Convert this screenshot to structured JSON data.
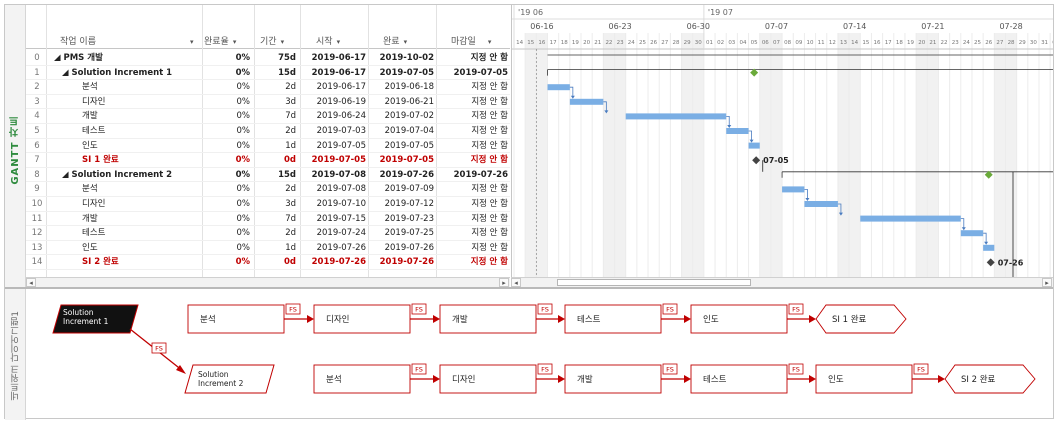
{
  "side_labels": {
    "gantt": "GANTT 차트",
    "network": "네트워크 다이어그램1"
  },
  "columns": {
    "name": "작업 이름",
    "pct": "완료율",
    "dur": "기간",
    "start": "시작",
    "end": "완료",
    "deadline": "마감일"
  },
  "rows": [
    {
      "id": "0",
      "name": "◢ PMS 개발",
      "pct": "0%",
      "dur": "75d",
      "start": "2019-06-17",
      "end": "2019-10-02",
      "deadline": "지정 안 함"
    },
    {
      "id": "1",
      "name": "◢ Solution Increment 1",
      "pct": "0%",
      "dur": "15d",
      "start": "2019-06-17",
      "end": "2019-07-05",
      "deadline": "2019-07-05"
    },
    {
      "id": "2",
      "name": "분석",
      "pct": "0%",
      "dur": "2d",
      "start": "2019-06-17",
      "end": "2019-06-18",
      "deadline": "지정 안 함"
    },
    {
      "id": "3",
      "name": "디자인",
      "pct": "0%",
      "dur": "3d",
      "start": "2019-06-19",
      "end": "2019-06-21",
      "deadline": "지정 안 함"
    },
    {
      "id": "4",
      "name": "개발",
      "pct": "0%",
      "dur": "7d",
      "start": "2019-06-24",
      "end": "2019-07-02",
      "deadline": "지정 안 함"
    },
    {
      "id": "5",
      "name": "테스트",
      "pct": "0%",
      "dur": "2d",
      "start": "2019-07-03",
      "end": "2019-07-04",
      "deadline": "지정 안 함"
    },
    {
      "id": "6",
      "name": "인도",
      "pct": "0%",
      "dur": "1d",
      "start": "2019-07-05",
      "end": "2019-07-05",
      "deadline": "지정 안 함"
    },
    {
      "id": "7",
      "name": "SI 1 완료",
      "pct": "0%",
      "dur": "0d",
      "start": "2019-07-05",
      "end": "2019-07-05",
      "deadline": "지정 안 함"
    },
    {
      "id": "8",
      "name": "◢ Solution Increment 2",
      "pct": "0%",
      "dur": "15d",
      "start": "2019-07-08",
      "end": "2019-07-26",
      "deadline": "2019-07-26"
    },
    {
      "id": "9",
      "name": "분석",
      "pct": "0%",
      "dur": "2d",
      "start": "2019-07-08",
      "end": "2019-07-09",
      "deadline": "지정 안 함"
    },
    {
      "id": "10",
      "name": "디자인",
      "pct": "0%",
      "dur": "3d",
      "start": "2019-07-10",
      "end": "2019-07-12",
      "deadline": "지정 안 함"
    },
    {
      "id": "11",
      "name": "개발",
      "pct": "0%",
      "dur": "7d",
      "start": "2019-07-15",
      "end": "2019-07-23",
      "deadline": "지정 안 함"
    },
    {
      "id": "12",
      "name": "테스트",
      "pct": "0%",
      "dur": "2d",
      "start": "2019-07-24",
      "end": "2019-07-25",
      "deadline": "지정 안 함"
    },
    {
      "id": "13",
      "name": "인도",
      "pct": "0%",
      "dur": "1d",
      "start": "2019-07-26",
      "end": "2019-07-26",
      "deadline": "지정 안 함"
    },
    {
      "id": "14",
      "name": "SI 2 완료",
      "pct": "0%",
      "dur": "0d",
      "start": "2019-07-26",
      "end": "2019-07-26",
      "deadline": "지정 안 함"
    }
  ],
  "row_styles": [
    "bold",
    "bold",
    "",
    "",
    "",
    "",
    "",
    "red",
    "bold",
    "",
    "",
    "",
    "",
    "",
    "red"
  ],
  "timeline": {
    "months": [
      "'19 06",
      "'19 07"
    ],
    "weeks": [
      "06-16",
      "06-23",
      "06-30",
      "07-07",
      "07-14",
      "07-21",
      "07-28"
    ],
    "days": [
      "14",
      "15",
      "16",
      "17",
      "18",
      "19",
      "20",
      "21",
      "22",
      "23",
      "24",
      "25",
      "26",
      "27",
      "28",
      "29",
      "30",
      "01",
      "02",
      "03",
      "04",
      "05",
      "06",
      "07",
      "08",
      "09",
      "10",
      "11",
      "12",
      "13",
      "14",
      "15",
      "16",
      "17",
      "18",
      "19",
      "20",
      "21",
      "22",
      "23",
      "24",
      "25",
      "26",
      "27",
      "28",
      "29",
      "30",
      "31",
      "01"
    ]
  },
  "milestone_labels": {
    "si1": "07-05",
    "si2": "07-26"
  },
  "network": {
    "dependency": "FS",
    "summary_boxes": [
      "Solution Increment 1",
      "Solution Increment 2"
    ],
    "row1": [
      "분석",
      "디자인",
      "개발",
      "테스트",
      "인도",
      "SI 1 완료"
    ],
    "row2": [
      "분석",
      "디자인",
      "개발",
      "테스트",
      "인도",
      "SI 2 완료"
    ]
  },
  "colors": {
    "bar": "#7aaee4",
    "accent_red": "#c00000",
    "summary_green": "#6aaa3a",
    "label_green": "#2e8b3e"
  }
}
